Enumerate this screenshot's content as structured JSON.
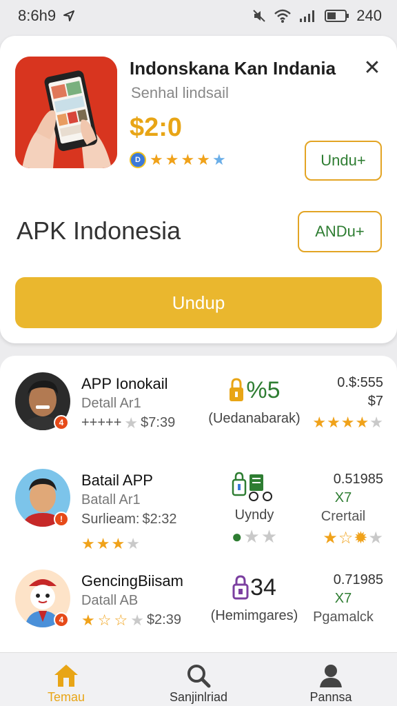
{
  "status_bar": {
    "time": "8:6h9",
    "battery": "240"
  },
  "app": {
    "title": "Indonskana Kan Indania",
    "subtitle": "Senhal lindsail",
    "price": "$2:0",
    "badge_letter": "D",
    "rating": 4,
    "install_label": "Undu+",
    "close_label": "✕"
  },
  "section": {
    "title": "APK Indonesia",
    "secondary_button": "ANDu+",
    "primary_button": "Undup"
  },
  "list": [
    {
      "title": "APP Ionokail",
      "subtitle": "Detall Ar1",
      "meta_prefix": "+++++",
      "meta_value": "$7:39",
      "badge": "4",
      "rating": 4,
      "mid_value": "%5",
      "mid_label": "(Uedanabarak)",
      "right_top": "0.$:555",
      "right_mid": "$7",
      "right_label": "",
      "right_rating": 4
    },
    {
      "title": "Batail APP",
      "subtitle": "Batall Ar1",
      "meta_prefix": "Surlieam:",
      "meta_value": "$2:32",
      "badge": "!",
      "rating": 3,
      "mid_value": "",
      "mid_label": "Uyndy",
      "right_top": "0.51985",
      "right_mid": "X7",
      "right_label": "Crertail",
      "right_rating": 2
    },
    {
      "title": "GencingBiisam",
      "subtitle": "Datall AB",
      "meta_prefix": "",
      "meta_value": "$2:39",
      "badge": "4",
      "rating": 2,
      "mid_value": "34",
      "mid_label": "(Hemimgares)",
      "right_top": "0.71985",
      "right_mid": "X7",
      "right_label": "Pgamalck",
      "right_rating": 0
    }
  ],
  "nav": [
    {
      "label": "Temau",
      "icon": "home-icon",
      "active": true
    },
    {
      "label": "Sanjinlriad",
      "icon": "search-icon",
      "active": false
    },
    {
      "label": "Pannsa",
      "icon": "profile-icon",
      "active": false
    }
  ],
  "colors": {
    "accent": "#eab72e",
    "green": "#2e7d32",
    "icon_bg": "#d8351f"
  }
}
